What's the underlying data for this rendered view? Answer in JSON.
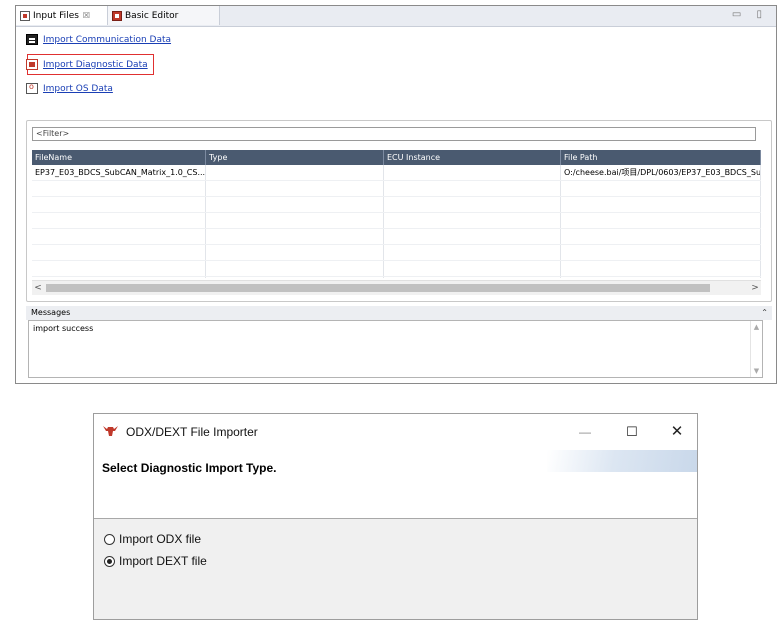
{
  "editor": {
    "tabs": [
      {
        "label": "Input Files",
        "close": "☒"
      },
      {
        "label": "Basic Editor"
      }
    ],
    "window_controls": "▭ ▯",
    "links": {
      "communication": "Import Communication Data",
      "diagnostic": "Import Diagnostic Data",
      "os": "Import OS Data"
    },
    "filter_placeholder": "<Filter>",
    "columns": [
      "FileName",
      "Type",
      "ECU Instance",
      "File Path"
    ],
    "rows": [
      [
        "EP37_E03_BDCS_SubCAN_Matrix_1.0_CS...",
        "",
        "",
        "O:/cheese.bai/项目/DPL/0603/EP37_E03_BDCS_Su"
      ]
    ],
    "scroll_left": "<",
    "scroll_right": ">",
    "messages_label": "Messages",
    "messages_toggle": "⌃",
    "messages_text": "import success"
  },
  "dialog": {
    "title": "ODX/DEXT File Importer",
    "minimize": "—",
    "maximize": "☐",
    "close": "✕",
    "heading": "Select Diagnostic Import Type.",
    "options": [
      {
        "label": "Import ODX file",
        "selected": false
      },
      {
        "label": "Import DEXT file",
        "selected": true
      }
    ]
  },
  "colors": {
    "link": "#1a3fb5",
    "highlight": "#e03030",
    "table_header": "#4a5a70",
    "logo": "#c0392b"
  }
}
